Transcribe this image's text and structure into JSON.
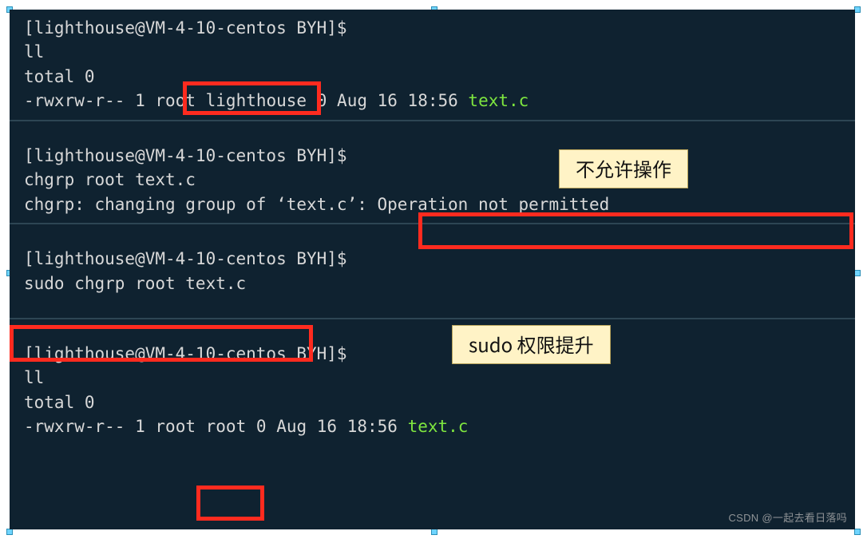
{
  "blocks": {
    "b1": {
      "prompt": "[lighthouse@VM-4-10-centos BYH]$",
      "cmd": "ll",
      "out1": "total 0",
      "ls": {
        "perms": "-rwxrw-r--",
        "links": "1",
        "owner": "root",
        "group": "lighthouse",
        "size": "0",
        "date": "Aug 16 18:56",
        "file": "text.c"
      }
    },
    "b2": {
      "prompt": "[lighthouse@VM-4-10-centos BYH]$",
      "cmd": "chgrp root text.c",
      "err_prefix": "chgrp: changing group of ‘text.c’: ",
      "err_msg": "Operation not permitted"
    },
    "b3": {
      "prompt": "[lighthouse@VM-4-10-centos BYH]$",
      "cmd": "sudo chgrp root text.c"
    },
    "b4": {
      "prompt": "[lighthouse@VM-4-10-centos BYH]$",
      "cmd": "ll",
      "out1": "total 0",
      "ls": {
        "perms": "-rwxrw-r--",
        "links": "1",
        "owner": "root",
        "group": "root",
        "size": "0",
        "date": "Aug 16 18:56",
        "file": "text.c"
      }
    }
  },
  "callouts": {
    "c1": "不允许操作",
    "c2": "sudo 权限提升"
  },
  "watermark": "CSDN @一起去看日落吗"
}
